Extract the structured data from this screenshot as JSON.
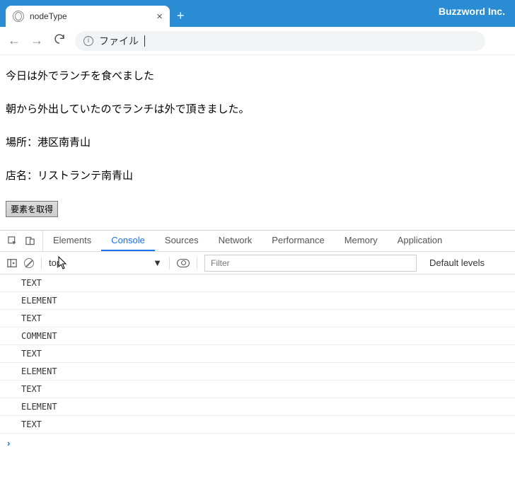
{
  "titlebar": {
    "tab_title": "nodeType",
    "brand": "Buzzword Inc."
  },
  "toolbar": {
    "addr_label": "ファイル"
  },
  "page": {
    "p1": "今日は外でランチを食べました",
    "p2": "朝から外出していたのでランチは外で頂きました。",
    "p3": "場所：港区南青山",
    "p4": "店名：リストランテ南青山",
    "button": "要素を取得"
  },
  "devtools": {
    "tabs": {
      "elements": "Elements",
      "console": "Console",
      "sources": "Sources",
      "network": "Network",
      "performance": "Performance",
      "memory": "Memory",
      "application": "Application"
    },
    "context": "top",
    "filter_placeholder": "Filter",
    "levels": "Default levels",
    "logs": [
      "TEXT",
      "ELEMENT",
      "TEXT",
      "COMMENT",
      "TEXT",
      "ELEMENT",
      "TEXT",
      "ELEMENT",
      "TEXT"
    ]
  }
}
